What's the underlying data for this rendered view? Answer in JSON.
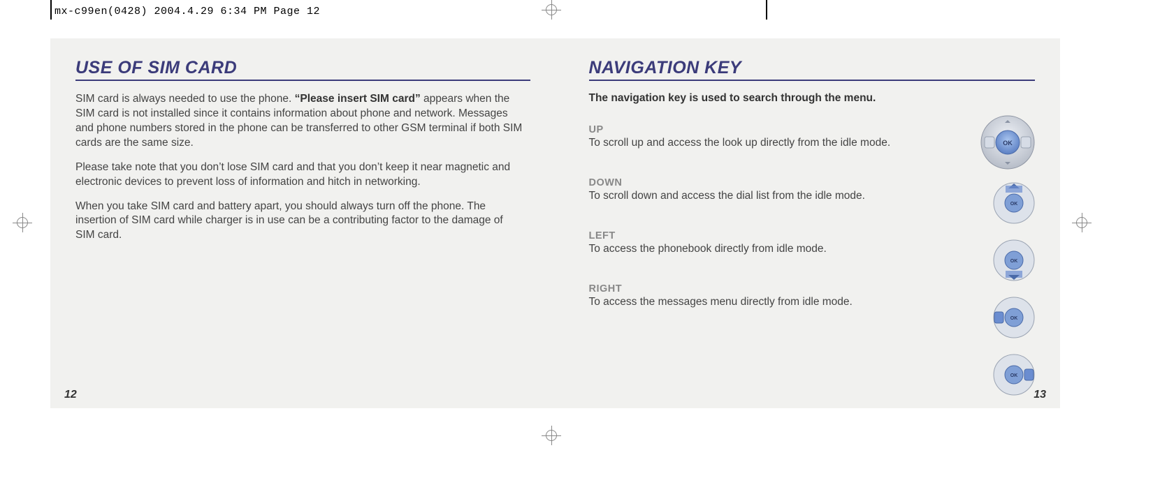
{
  "slug": "mx-c99en(0428)  2004.4.29  6:34 PM  Page 12",
  "left": {
    "heading": "USE OF SIM CARD",
    "p1_prefix": "SIM card is always needed to use the phone. ",
    "p1_bold": "“Please insert SIM card”",
    "p1_suffix": " appears when the SIM card is not installed since it contains information about phone and network. Messages and phone numbers stored in the phone can be transferred to other GSM terminal if both SIM cards are the same size.",
    "p2": "Please take note that you don’t lose SIM card and that you don’t keep it near magnetic and electronic devices to prevent loss of information and hitch in networking.",
    "p3": "When you take SIM card and battery apart, you should always turn off the phone. The insertion of SIM card while charger is in use can be a contributing factor to the damage of SIM card.",
    "page": "12"
  },
  "right": {
    "heading": "NAVIGATION KEY",
    "lead": "The navigation key is used to search through the menu.",
    "items": [
      {
        "label": "UP",
        "desc": "To scroll up and access the look up directly from the idle mode."
      },
      {
        "label": "DOWN",
        "desc": "To scroll down and access the dial list from the idle mode."
      },
      {
        "label": "LEFT",
        "desc": "To access the phonebook directly from idle mode."
      },
      {
        "label": "RIGHT",
        "desc": "To access the messages menu directly from idle mode."
      }
    ],
    "page": "13"
  }
}
